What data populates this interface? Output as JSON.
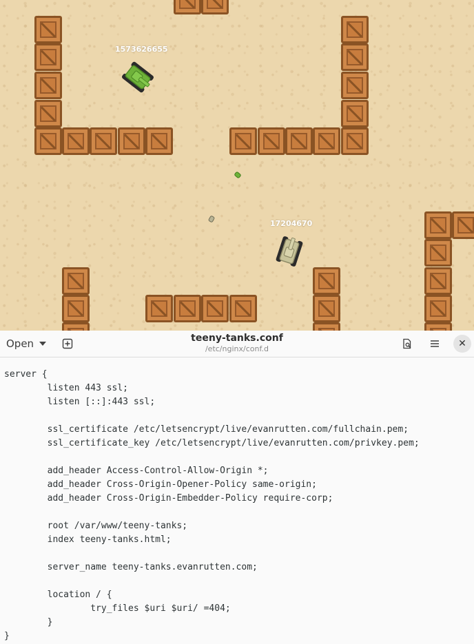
{
  "game": {
    "player_tank": {
      "id_label": "1573626655",
      "color": "#6fb23a"
    },
    "enemy_tank": {
      "id_label": "17204670",
      "color": "#c8c49a"
    },
    "sand_color": "#ecd7ad",
    "crate_color": "#cf8849"
  },
  "editor": {
    "open_label": "Open",
    "title": "teeny-tanks.conf",
    "subtitle": "/etc/nginx/conf.d",
    "icons": [
      "new-tab-icon",
      "search-document-icon",
      "hamburger-menu-icon",
      "close-icon"
    ],
    "close_glyph": "✕",
    "lines": [
      "server {",
      "        listen 443 ssl;",
      "        listen [::]:443 ssl;",
      "",
      "        ssl_certificate /etc/letsencrypt/live/evanrutten.com/fullchain.pem;",
      "        ssl_certificate_key /etc/letsencrypt/live/evanrutten.com/privkey.pem;",
      "",
      "        add_header Access-Control-Allow-Origin *;",
      "        add_header Cross-Origin-Opener-Policy same-origin;",
      "        add_header Cross-Origin-Embedder-Policy require-corp;",
      "",
      "        root /var/www/teeny-tanks;",
      "        index teeny-tanks.html;",
      "",
      "        server_name teeny-tanks.evanrutten.com;",
      "",
      "        location / {",
      "                try_files $uri $uri/ =404;",
      "        }",
      "}"
    ]
  }
}
